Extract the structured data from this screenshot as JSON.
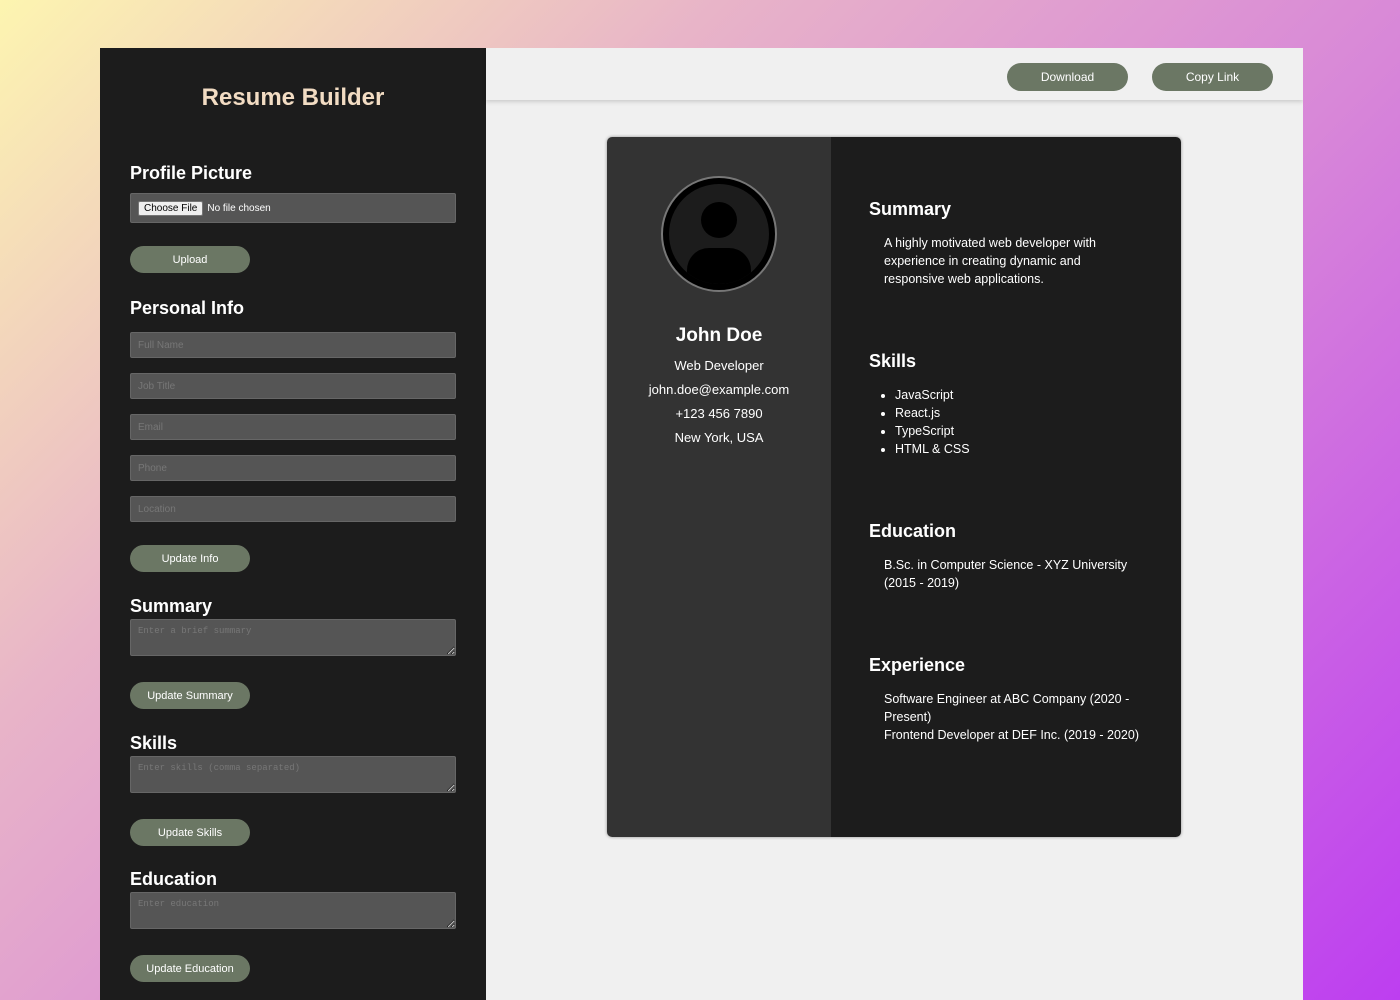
{
  "sidebar": {
    "title": "Resume Builder",
    "profile_picture": {
      "heading": "Profile Picture",
      "file_button": "Choose File",
      "file_status": "No file chosen",
      "upload_label": "Upload"
    },
    "personal_info": {
      "heading": "Personal Info",
      "full_name_placeholder": "Full Name",
      "job_title_placeholder": "Job Title",
      "email_placeholder": "Email",
      "phone_placeholder": "Phone",
      "location_placeholder": "Location",
      "update_label": "Update Info"
    },
    "summary": {
      "heading": "Summary",
      "placeholder": "Enter a brief summary",
      "update_label": "Update Summary"
    },
    "skills": {
      "heading": "Skills",
      "placeholder": "Enter skills (comma separated)",
      "update_label": "Update Skills"
    },
    "education": {
      "heading": "Education",
      "placeholder": "Enter education",
      "update_label": "Update Education"
    }
  },
  "toolbar": {
    "download_label": "Download",
    "copy_link_label": "Copy Link"
  },
  "resume": {
    "name": "John Doe",
    "job_title": "Web Developer",
    "email": "john.doe@example.com",
    "phone": "+123 456 7890",
    "location": "New York, USA",
    "summary_heading": "Summary",
    "summary_text": "A highly motivated web developer with experience in creating dynamic and responsive web applications.",
    "skills_heading": "Skills",
    "skills": [
      "JavaScript",
      "React.js",
      "TypeScript",
      "HTML & CSS"
    ],
    "education_heading": "Education",
    "education_text": "B.Sc. in Computer Science - XYZ University (2015 - 2019)",
    "experience_heading": "Experience",
    "experience": [
      "Software Engineer at ABC Company (2020 - Present)",
      "Frontend Developer at DEF Inc. (2019 - 2020)"
    ]
  },
  "colors": {
    "sidebar_bg": "#1c1c1c",
    "title_color": "#f2dcc3",
    "button_bg": "#6b7764",
    "input_bg": "#555555",
    "resume_left_bg": "#333333",
    "resume_right_bg": "#1c1c1c",
    "main_bg": "#f0f0f0"
  },
  "icons": {
    "avatar": "user-avatar-icon"
  }
}
